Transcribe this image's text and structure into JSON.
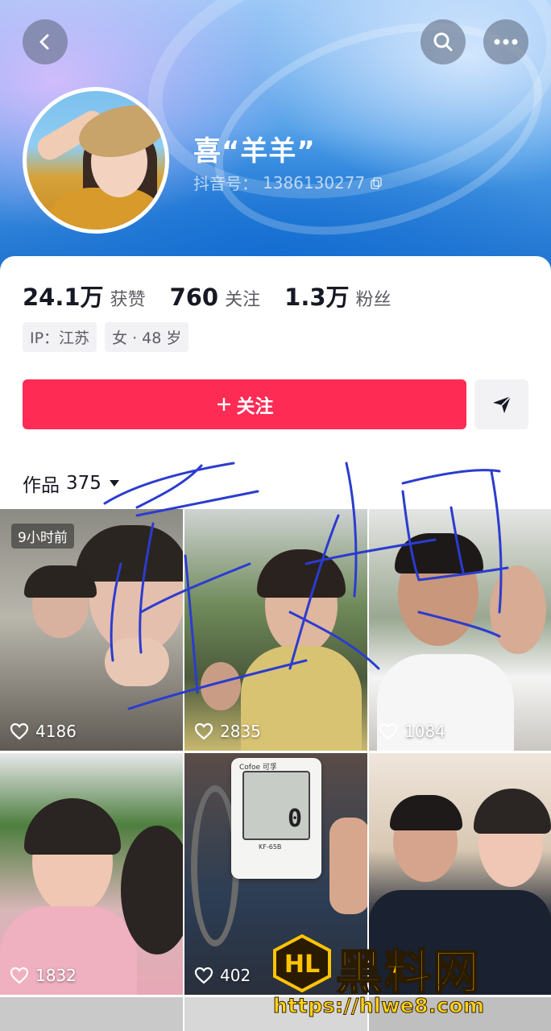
{
  "header": {
    "name": "喜“羊羊”",
    "douyin_id_label": "抖音号：",
    "douyin_id": "1386130277"
  },
  "stats": [
    {
      "value": "24.1万",
      "label": "获赞"
    },
    {
      "value": "760",
      "label": "关注"
    },
    {
      "value": "1.3万",
      "label": "粉丝"
    }
  ],
  "tags": [
    "IP：江苏",
    "女 · 48 岁"
  ],
  "follow_button": {
    "label": "关注",
    "icon": "plus-icon"
  },
  "works_tab": {
    "label": "作品",
    "count": "375"
  },
  "videos": [
    {
      "likes": "4186",
      "time_badge": "9小时前"
    },
    {
      "likes": "2835"
    },
    {
      "likes": "1084"
    },
    {
      "likes": "1832"
    },
    {
      "likes": "402",
      "device_brand": "Cofoe 可孚",
      "device_model": "KF-65B",
      "device_display": "0"
    },
    {
      "likes": ""
    }
  ],
  "watermark": {
    "logo": "HL",
    "title": "黑料网",
    "url": "https://hlwe8.com"
  },
  "colors": {
    "accent": "#fe2c55",
    "text": "#161823",
    "muted": "#5b5c63",
    "chip_bg": "#f2f2f4"
  }
}
